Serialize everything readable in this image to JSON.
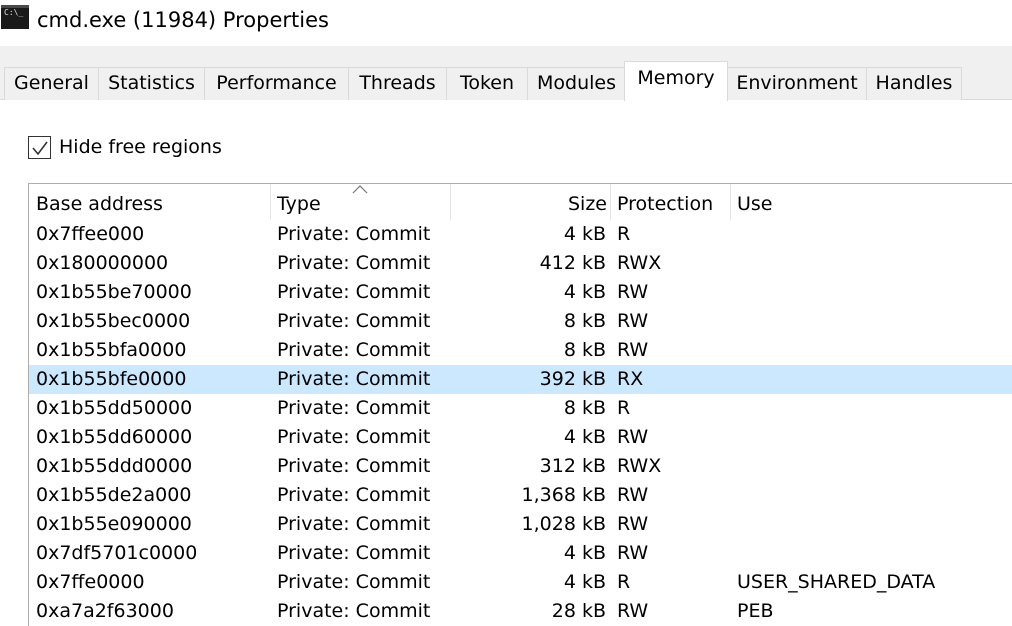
{
  "window": {
    "title": "cmd.exe (11984) Properties",
    "icon": "cmd-icon"
  },
  "tabs": [
    {
      "label": "General",
      "active": false
    },
    {
      "label": "Statistics",
      "active": false
    },
    {
      "label": "Performance",
      "active": false
    },
    {
      "label": "Threads",
      "active": false
    },
    {
      "label": "Token",
      "active": false
    },
    {
      "label": "Modules",
      "active": false
    },
    {
      "label": "Memory",
      "active": true
    },
    {
      "label": "Environment",
      "active": false
    },
    {
      "label": "Handles",
      "active": false
    }
  ],
  "options": {
    "hide_free_regions_label": "Hide free regions",
    "hide_free_regions_checked": true
  },
  "columns": {
    "base_address": "Base address",
    "type": "Type",
    "size": "Size",
    "protection": "Protection",
    "use": "Use",
    "sorted_column": "type",
    "sort_direction": "ascending"
  },
  "rows": [
    {
      "base": "0x7ffee000",
      "type": "Private: Commit",
      "size": "4 kB",
      "protection": "R",
      "use": ""
    },
    {
      "base": "0x180000000",
      "type": "Private: Commit",
      "size": "412 kB",
      "protection": "RWX",
      "use": ""
    },
    {
      "base": "0x1b55be70000",
      "type": "Private: Commit",
      "size": "4 kB",
      "protection": "RW",
      "use": ""
    },
    {
      "base": "0x1b55bec0000",
      "type": "Private: Commit",
      "size": "8 kB",
      "protection": "RW",
      "use": ""
    },
    {
      "base": "0x1b55bfa0000",
      "type": "Private: Commit",
      "size": "8 kB",
      "protection": "RW",
      "use": ""
    },
    {
      "base": "0x1b55bfe0000",
      "type": "Private: Commit",
      "size": "392 kB",
      "protection": "RX",
      "use": "",
      "selected": true
    },
    {
      "base": "0x1b55dd50000",
      "type": "Private: Commit",
      "size": "8 kB",
      "protection": "R",
      "use": ""
    },
    {
      "base": "0x1b55dd60000",
      "type": "Private: Commit",
      "size": "4 kB",
      "protection": "RW",
      "use": ""
    },
    {
      "base": "0x1b55ddd0000",
      "type": "Private: Commit",
      "size": "312 kB",
      "protection": "RWX",
      "use": ""
    },
    {
      "base": "0x1b55de2a000",
      "type": "Private: Commit",
      "size": "1,368 kB",
      "protection": "RW",
      "use": ""
    },
    {
      "base": "0x1b55e090000",
      "type": "Private: Commit",
      "size": "1,028 kB",
      "protection": "RW",
      "use": ""
    },
    {
      "base": "0x7df5701c0000",
      "type": "Private: Commit",
      "size": "4 kB",
      "protection": "RW",
      "use": ""
    },
    {
      "base": "0x7ffe0000",
      "type": "Private: Commit",
      "size": "4 kB",
      "protection": "R",
      "use": "USER_SHARED_DATA"
    },
    {
      "base": "0xa7a2f63000",
      "type": "Private: Commit",
      "size": "28 kB",
      "protection": "RW",
      "use": "PEB"
    }
  ],
  "colors": {
    "selected_row": "#cce8ff",
    "tab_strip": "#f0f0f0"
  }
}
